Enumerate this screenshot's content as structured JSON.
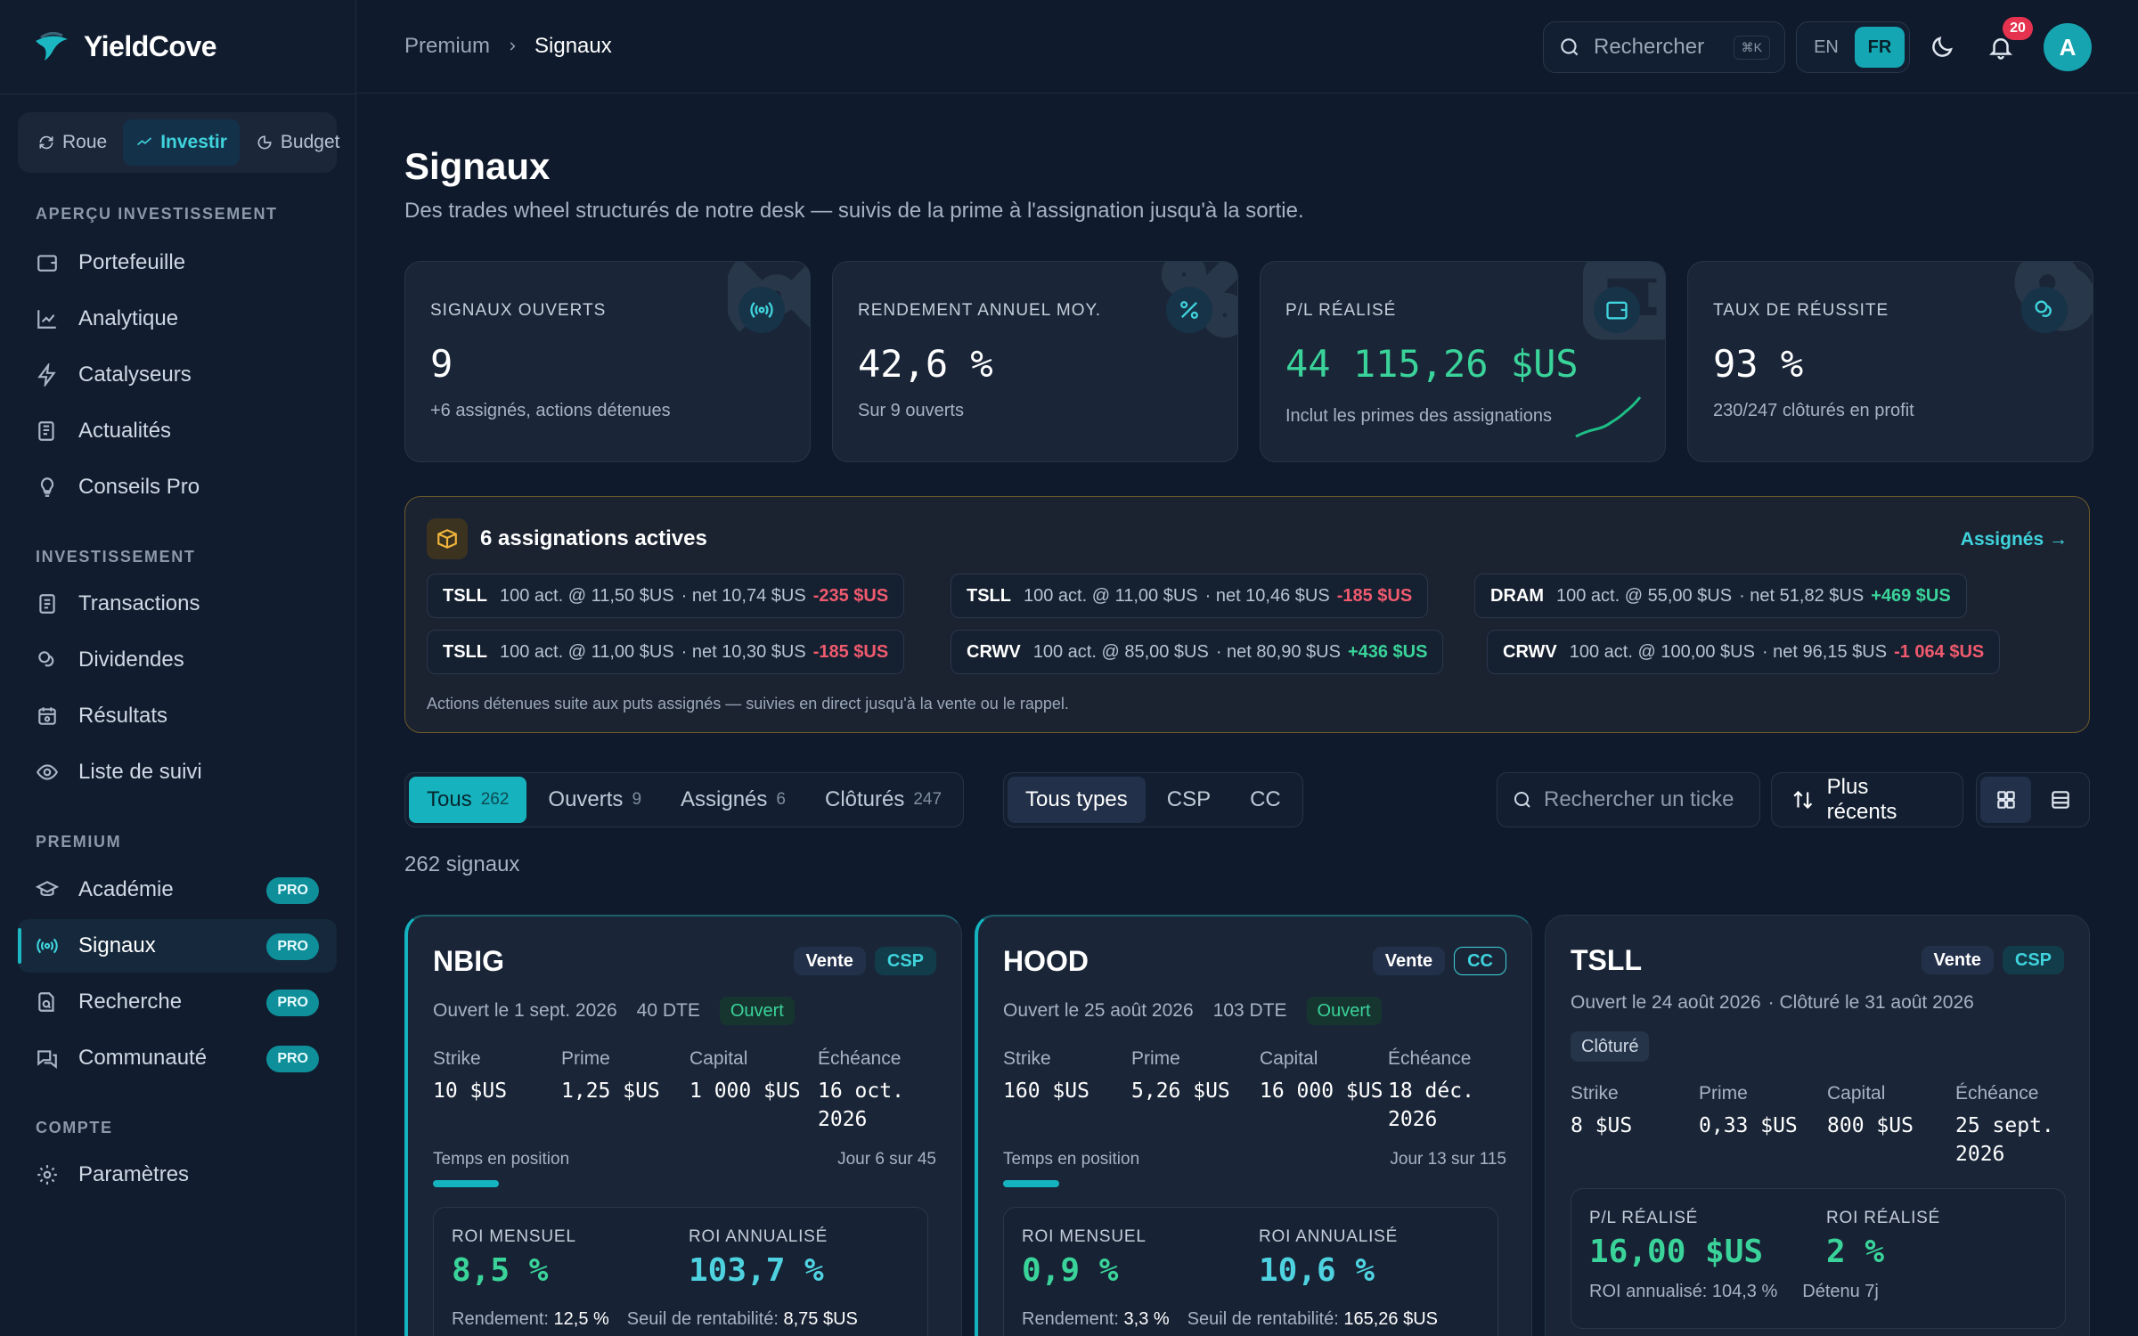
{
  "app": {
    "name": "YieldCove"
  },
  "modes": [
    {
      "label": "Roue",
      "icon": "refresh-icon"
    },
    {
      "label": "Investir",
      "icon": "trend-icon"
    },
    {
      "label": "Budget",
      "icon": "pie-icon"
    }
  ],
  "sidebar": {
    "section1": "APERÇU INVESTISSEMENT",
    "section2": "INVESTISSEMENT",
    "section3": "PREMIUM",
    "section4": "COMPTE",
    "items": {
      "portefeuille": "Portefeuille",
      "analytique": "Analytique",
      "catalyseurs": "Catalyseurs",
      "actualites": "Actualités",
      "conseils": "Conseils Pro",
      "transactions": "Transactions",
      "dividendes": "Dividendes",
      "resultats": "Résultats",
      "suivi": "Liste de suivi",
      "academie": "Académie",
      "signaux": "Signaux",
      "recherche": "Recherche",
      "communaute": "Communauté",
      "parametres": "Paramètres"
    },
    "pro_label": "PRO"
  },
  "topbar": {
    "breadcrumb": [
      "Premium",
      "Signaux"
    ],
    "search_placeholder": "Rechercher",
    "search_kbd": "⌘K",
    "lang": [
      "EN",
      "FR"
    ],
    "notifications": "20",
    "avatar": "A"
  },
  "page": {
    "title": "Signaux",
    "subtitle": "Des trades wheel structurés de notre desk — suivis de la prime à l'assignation jusqu'à la sortie."
  },
  "stats": [
    {
      "label": "SIGNAUX OUVERTS",
      "value": "9",
      "note": "+6 assignés, actions détenues",
      "icon": "broadcast-icon"
    },
    {
      "label": "RENDEMENT ANNUEL MOY.",
      "value": "42,6 %",
      "note": "Sur 9 ouverts",
      "icon": "percent-icon"
    },
    {
      "label": "P/L RÉALISÉ",
      "value": "44 115,26 $US",
      "note": "Inclut les primes des assignations",
      "icon": "wallet-icon"
    },
    {
      "label": "TAUX DE RÉUSSITE",
      "value": "93 %",
      "note": "230/247 clôturés en profit",
      "icon": "coins-icon"
    }
  ],
  "assignments": {
    "title": "6 assignations actives",
    "link": "Assignés →",
    "footer": "Actions détenues suite aux puts assignés — suivies en direct jusqu'à la vente ou le rappel.",
    "chips": [
      {
        "ticker": "TSLL",
        "desc": "100 act. @ 11,50 $US",
        "net": "· net 10,74 $US",
        "pl": "-235 $US",
        "dir": "neg"
      },
      {
        "ticker": "TSLL",
        "desc": "100 act. @ 11,00 $US",
        "net": "· net 10,46 $US",
        "pl": "-185 $US",
        "dir": "neg"
      },
      {
        "ticker": "DRAM",
        "desc": "100 act. @ 55,00 $US",
        "net": "· net 51,82 $US",
        "pl": "+469 $US",
        "dir": "pos"
      },
      {
        "ticker": "TSLL",
        "desc": "100 act. @ 11,00 $US",
        "net": "· net 10,30 $US",
        "pl": "-185 $US",
        "dir": "neg"
      },
      {
        "ticker": "CRWV",
        "desc": "100 act. @ 85,00 $US",
        "net": "· net 80,90 $US",
        "pl": "+436 $US",
        "dir": "pos"
      },
      {
        "ticker": "CRWV",
        "desc": "100 act. @ 100,00 $US",
        "net": "· net 96,15 $US",
        "pl": "-1 064 $US",
        "dir": "neg"
      }
    ]
  },
  "filters": {
    "status": [
      {
        "label": "Tous",
        "count": "262"
      },
      {
        "label": "Ouverts",
        "count": "9"
      },
      {
        "label": "Assignés",
        "count": "6"
      },
      {
        "label": "Clôturés",
        "count": "247"
      }
    ],
    "types": [
      "Tous types",
      "CSP",
      "CC"
    ],
    "search_placeholder": "Rechercher un ticke",
    "sort": "Plus récents"
  },
  "count_line": "262 signaux",
  "cards": [
    {
      "ticker": "NBIG",
      "side": "Vente",
      "type": "CSP",
      "opened": "Ouvert le 1 sept. 2026",
      "dte": "40 DTE",
      "status": "Ouvert",
      "strike_k": "Strike",
      "strike": "10 $US",
      "prime_k": "Prime",
      "prime": "1,25 $US",
      "capital_k": "Capital",
      "capital": "1 000 $US",
      "echeance_k": "Échéance",
      "echeance": "16 oct. 2026",
      "progress_label": "Temps en position",
      "progress_day": "Jour 6 sur 45",
      "progress": 0.133,
      "roi_m_label": "ROI MENSUEL",
      "roi_m": "8,5 %",
      "roi_a_label": "ROI ANNUALISÉ",
      "roi_a": "103,7 %",
      "rendement_k": "Rendement:",
      "rendement": "12,5 %",
      "seuil_k": "Seuil de rentabilité:",
      "seuil": "8,75 $US"
    },
    {
      "ticker": "HOOD",
      "side": "Vente",
      "type": "CC",
      "opened": "Ouvert le 25 août 2026",
      "dte": "103 DTE",
      "status": "Ouvert",
      "strike_k": "Strike",
      "strike": "160 $US",
      "prime_k": "Prime",
      "prime": "5,26 $US",
      "capital_k": "Capital",
      "capital": "16 000 $US",
      "echeance_k": "Échéance",
      "echeance": "18 déc. 2026",
      "progress_label": "Temps en position",
      "progress_day": "Jour 13 sur 115",
      "progress": 0.113,
      "roi_m_label": "ROI MENSUEL",
      "roi_m": "0,9 %",
      "roi_a_label": "ROI ANNUALISÉ",
      "roi_a": "10,6 %",
      "rendement_k": "Rendement:",
      "rendement": "3,3 %",
      "seuil_k": "Seuil de rentabilité:",
      "seuil": "165,26 $US"
    },
    {
      "ticker": "TSLL",
      "side": "Vente",
      "type": "CSP",
      "opened": "Ouvert le 24 août 2026",
      "closed": "· Clôturé le 31 août 2026",
      "status": "Clôturé",
      "strike_k": "Strike",
      "strike": "8 $US",
      "prime_k": "Prime",
      "prime": "0,33 $US",
      "capital_k": "Capital",
      "capital": "800 $US",
      "echeance_k": "Échéance",
      "echeance": "25 sept. 2026",
      "pl_label": "P/L RÉALISÉ",
      "pl": "16,00 $US",
      "roi_r_label": "ROI RÉALISÉ",
      "roi_r": "2 %",
      "roi_ann": "ROI annualisé: 104,3 %",
      "held": "Détenu 7j"
    }
  ],
  "colors": {
    "accent": "#14b3bf",
    "positive": "#3ad39a",
    "negative": "#f05a6e",
    "warning": "#f1b53c"
  }
}
